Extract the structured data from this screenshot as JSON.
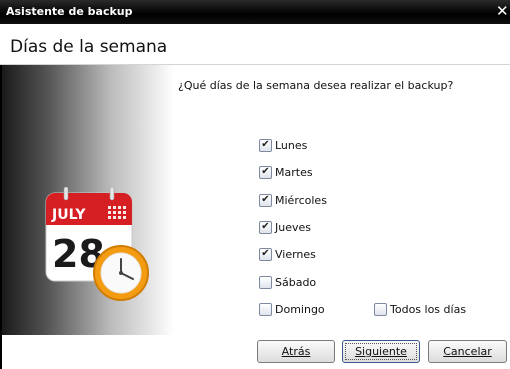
{
  "window": {
    "title": "Asistente de backup",
    "close_glyph": "✕"
  },
  "page": {
    "heading": "Días de la semana",
    "question": "¿Qué días de la semana desea realizar el backup?"
  },
  "illustration": {
    "month": "JULY",
    "day": "28",
    "icon": "calendar-clock-icon"
  },
  "days": [
    {
      "label": "Lunes",
      "checked": true
    },
    {
      "label": "Martes",
      "checked": true
    },
    {
      "label": "Miércoles",
      "checked": true
    },
    {
      "label": "Jueves",
      "checked": true
    },
    {
      "label": "Viernes",
      "checked": true
    },
    {
      "label": "Sábado",
      "checked": false
    },
    {
      "label": "Domingo",
      "checked": false
    }
  ],
  "all_days": {
    "label": "Todos los días",
    "checked": false
  },
  "buttons": {
    "back": "Atrás",
    "next": "Siguiente",
    "cancel": "Cancelar"
  },
  "colors": {
    "titlebar": "#000000",
    "calendar_red": "#d61f23",
    "clock_orange": "#f39c12"
  }
}
